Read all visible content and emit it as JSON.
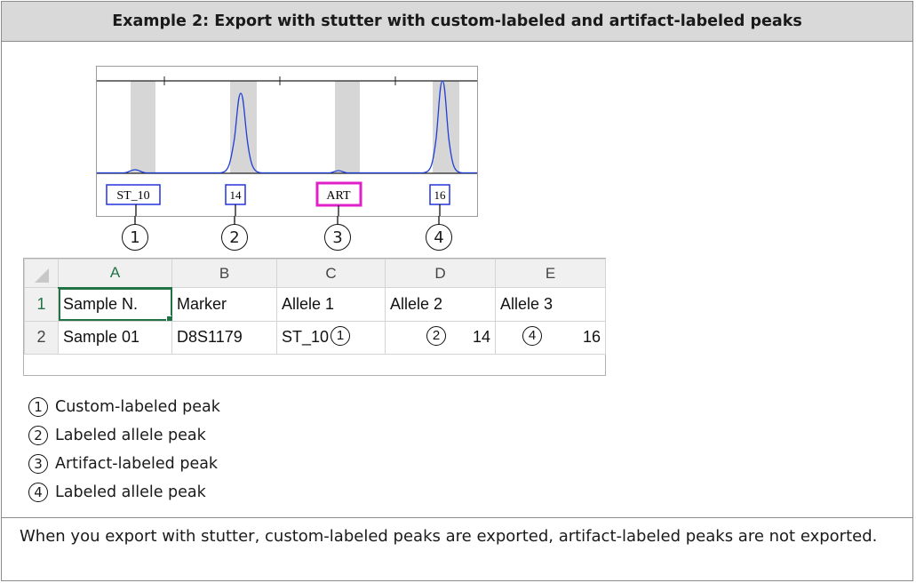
{
  "header": {
    "title": "Example 2: Export with stutter with custom-labeled and artifact-labeled peaks"
  },
  "figure": {
    "labels": [
      "ST_10",
      "14",
      "ART",
      "16"
    ],
    "callouts": [
      "1",
      "2",
      "3",
      "4"
    ],
    "colors": {
      "trace": "#1f3fd6",
      "label_border": "#2233dd",
      "artifact_border": "#e020c8",
      "bin": "#d6d6d6"
    }
  },
  "sheet": {
    "columns": [
      "A",
      "B",
      "C",
      "D",
      "E"
    ],
    "row_numbers": [
      "1",
      "2"
    ],
    "rows": [
      [
        "Sample N.",
        "Marker",
        "Allele 1",
        "Allele 2",
        "Allele 3"
      ],
      [
        "Sample 01",
        "D8S1179",
        "ST_10",
        "14",
        "16"
      ]
    ],
    "inline_callouts": [
      "1",
      "2",
      "4"
    ],
    "accent": "#217346"
  },
  "legend": [
    {
      "num": "1",
      "text": "Custom-labeled peak"
    },
    {
      "num": "2",
      "text": "Labeled allele peak"
    },
    {
      "num": "3",
      "text": "Artifact-labeled peak"
    },
    {
      "num": "4",
      "text": "Labeled allele peak"
    }
  ],
  "note": "When you export with stutter, custom-labeled peaks are exported, artifact-labeled peaks are not exported."
}
